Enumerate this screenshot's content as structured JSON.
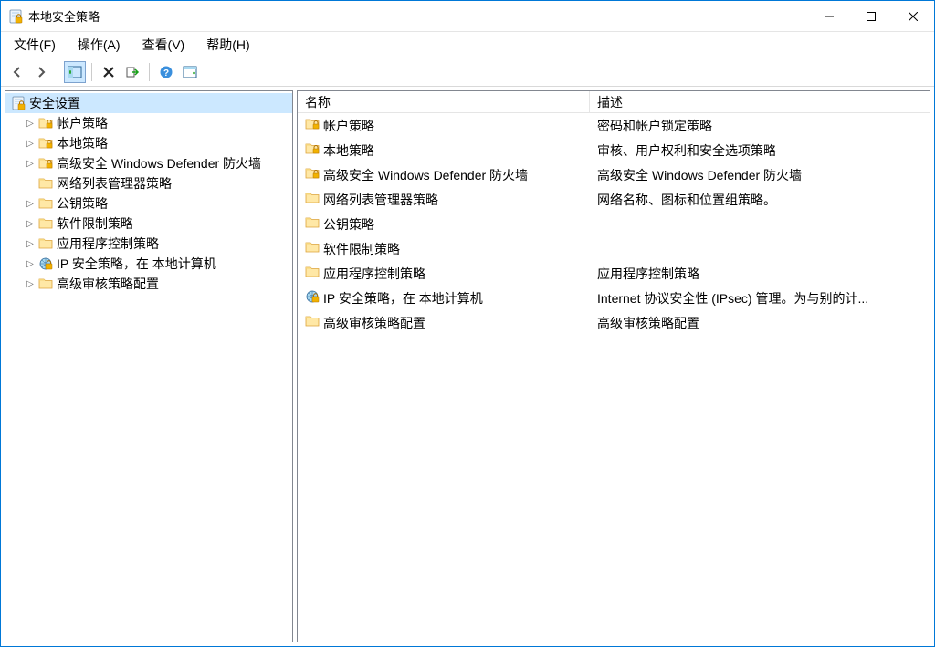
{
  "window": {
    "title": "本地安全策略"
  },
  "menubar": {
    "file": "文件(F)",
    "action": "操作(A)",
    "view": "查看(V)",
    "help": "帮助(H)"
  },
  "tree": {
    "root": "安全设置",
    "items": [
      {
        "label": "帐户策略",
        "expandable": true,
        "icon": "folder-lock"
      },
      {
        "label": "本地策略",
        "expandable": true,
        "icon": "folder-lock"
      },
      {
        "label": "高级安全 Windows Defender 防火墙",
        "expandable": true,
        "icon": "folder-lock"
      },
      {
        "label": "网络列表管理器策略",
        "expandable": false,
        "icon": "folder"
      },
      {
        "label": "公钥策略",
        "expandable": true,
        "icon": "folder"
      },
      {
        "label": "软件限制策略",
        "expandable": true,
        "icon": "folder"
      },
      {
        "label": "应用程序控制策略",
        "expandable": true,
        "icon": "folder"
      },
      {
        "label": "IP 安全策略，在 本地计算机",
        "expandable": true,
        "icon": "ipsec"
      },
      {
        "label": "高级审核策略配置",
        "expandable": true,
        "icon": "folder"
      }
    ]
  },
  "list": {
    "columns": {
      "name": "名称",
      "description": "描述"
    },
    "rows": [
      {
        "name": "帐户策略",
        "desc": "密码和帐户锁定策略",
        "icon": "folder-lock"
      },
      {
        "name": "本地策略",
        "desc": "审核、用户权利和安全选项策略",
        "icon": "folder-lock"
      },
      {
        "name": "高级安全 Windows Defender 防火墙",
        "desc": "高级安全 Windows Defender 防火墙",
        "icon": "folder-lock"
      },
      {
        "name": "网络列表管理器策略",
        "desc": "网络名称、图标和位置组策略。",
        "icon": "folder"
      },
      {
        "name": "公钥策略",
        "desc": "",
        "icon": "folder"
      },
      {
        "name": "软件限制策略",
        "desc": "",
        "icon": "folder"
      },
      {
        "name": "应用程序控制策略",
        "desc": "应用程序控制策略",
        "icon": "folder"
      },
      {
        "name": "IP 安全策略，在 本地计算机",
        "desc": "Internet 协议安全性 (IPsec) 管理。为与别的计...",
        "icon": "ipsec"
      },
      {
        "name": "高级审核策略配置",
        "desc": "高级审核策略配置",
        "icon": "folder"
      }
    ]
  }
}
